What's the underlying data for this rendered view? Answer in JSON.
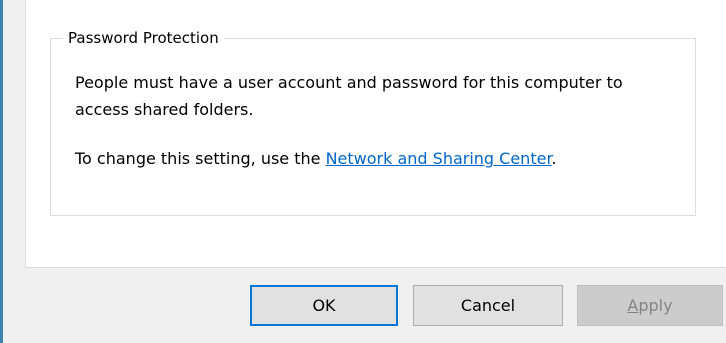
{
  "password_protection": {
    "group_title": "Password Protection",
    "description": "People must have a user account and password for this computer to access shared folders.",
    "change_prefix": "To change this setting, use the ",
    "link_text": "Network and Sharing Center",
    "change_suffix": "."
  },
  "buttons": {
    "ok": "OK",
    "cancel": "Cancel",
    "apply_mnemonic": "A",
    "apply_rest": "pply",
    "apply_enabled": false
  },
  "colors": {
    "link": "#0066cc",
    "focus_border": "#0078d7",
    "accent_left": "#3c7fb1"
  }
}
